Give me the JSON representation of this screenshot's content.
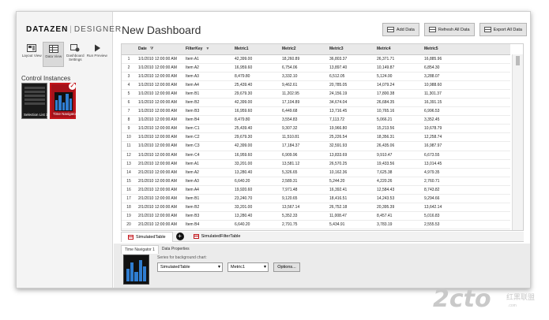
{
  "app": {
    "logo_bold": "DATAZEN",
    "logo_light": "DESIGNER"
  },
  "views": [
    {
      "label": "Layout View",
      "icon": "layout-icon"
    },
    {
      "label": "Data View",
      "icon": "data-view-icon"
    },
    {
      "label": "Dashboard Settings",
      "icon": "dashboard-settings-icon"
    },
    {
      "label": "Run Preview",
      "icon": "play-icon"
    }
  ],
  "control_instances": {
    "title": "Control Instances",
    "items": [
      {
        "label": "Selection List 1"
      },
      {
        "label": "Time Navigator 1"
      }
    ]
  },
  "dashboard": {
    "title": "New Dashboard"
  },
  "toolbar": {
    "add_data": "Add Data",
    "refresh_all": "Refresh All Data",
    "export_all": "Export All Data"
  },
  "table": {
    "columns": [
      "",
      "Date",
      "FilterKey",
      "Metric1",
      "Metric2",
      "Metric3",
      "Metric4",
      "Metric5"
    ],
    "rows": [
      [
        "1",
        "1/1/2010 12:00:00 AM",
        "Item A1",
        "42,399.00",
        "18,260.89",
        "36,803.37",
        "26,371.71",
        "16,885.96"
      ],
      [
        "2",
        "1/1/2010 12:00:00 AM",
        "Item A2",
        "16,959.60",
        "6,754.06",
        "13,897.40",
        "10,149.87",
        "6,854.30"
      ],
      [
        "3",
        "1/1/2010 12:00:00 AM",
        "Item A3",
        "8,479.80",
        "3,332.10",
        "6,512.05",
        "5,124.00",
        "3,288.07"
      ],
      [
        "4",
        "1/1/2010 12:00:00 AM",
        "Item A4",
        "25,439.40",
        "9,462.61",
        "20,785.05",
        "14,079.24",
        "10,988.60"
      ],
      [
        "5",
        "1/1/2010 12:00:00 AM",
        "Item B1",
        "29,679.30",
        "11,202.95",
        "24,156.19",
        "17,800.38",
        "11,301.37"
      ],
      [
        "6",
        "1/1/2010 12:00:00 AM",
        "Item B2",
        "42,399.00",
        "17,104.89",
        "34,674.04",
        "26,684.35",
        "16,391.15"
      ],
      [
        "7",
        "1/1/2010 12:00:00 AM",
        "Item B3",
        "16,959.60",
        "6,449.68",
        "13,716.45",
        "10,765.16",
        "6,996.53"
      ],
      [
        "8",
        "1/1/2010 12:00:00 AM",
        "Item B4",
        "8,479.80",
        "3,554.83",
        "7,113.72",
        "5,066.21",
        "3,352.45"
      ],
      [
        "9",
        "1/1/2010 12:00:00 AM",
        "Item C1",
        "25,439.40",
        "9,307.32",
        "19,966.80",
        "15,213.56",
        "10,678.79"
      ],
      [
        "10",
        "1/1/2010 12:00:00 AM",
        "Item C2",
        "29,679.30",
        "11,510.81",
        "25,226.54",
        "18,356.31",
        "12,258.74"
      ],
      [
        "11",
        "1/1/2010 12:00:00 AM",
        "Item C3",
        "42,399.00",
        "17,184.37",
        "32,591.93",
        "26,435.06",
        "16,987.97"
      ],
      [
        "12",
        "1/1/2010 12:00:00 AM",
        "Item C4",
        "16,959.60",
        "6,909.96",
        "13,833.69",
        "9,910.47",
        "6,673.55"
      ],
      [
        "13",
        "2/1/2010 12:00:00 AM",
        "Item A1",
        "33,201.00",
        "13,581.12",
        "26,570.25",
        "19,433.56",
        "13,014.45"
      ],
      [
        "14",
        "2/1/2010 12:00:00 AM",
        "Item A2",
        "13,280.40",
        "5,326.65",
        "10,162.36",
        "7,625.38",
        "4,979.35"
      ],
      [
        "15",
        "2/1/2010 12:00:00 AM",
        "Item A3",
        "6,640.20",
        "2,589.31",
        "5,244.20",
        "4,220.26",
        "2,760.71"
      ],
      [
        "16",
        "2/1/2010 12:00:00 AM",
        "Item A4",
        "19,920.60",
        "7,971.48",
        "16,392.41",
        "12,584.43",
        "8,743.82"
      ],
      [
        "17",
        "2/1/2010 12:00:00 AM",
        "Item B1",
        "23,240.70",
        "9,120.65",
        "18,416.51",
        "14,243.53",
        "9,294.66"
      ],
      [
        "18",
        "2/1/2010 12:00:00 AM",
        "Item B2",
        "33,201.00",
        "13,567.14",
        "26,752.18",
        "20,395.39",
        "13,642.14"
      ],
      [
        "19",
        "2/1/2010 12:00:00 AM",
        "Item B3",
        "13,280.40",
        "5,352.33",
        "11,008.47",
        "8,457.41",
        "5,016.83"
      ],
      [
        "20",
        "2/1/2010 12:00:00 AM",
        "Item B4",
        "6,640.20",
        "2,791.75",
        "5,434.91",
        "3,783.19",
        "2,555.53"
      ]
    ]
  },
  "tabs": {
    "items": [
      "SimulatedTable",
      "SimulatedFilterTable"
    ]
  },
  "bottom": {
    "tabs": [
      "Time Navigator 1",
      "Data Properties"
    ],
    "series_label": "Series for background chart:",
    "table_select": "SimulatedTable",
    "metric_select": "Metric1",
    "options_button": "Options..."
  },
  "watermark": {
    "main": "2cto",
    "sub": "红黑联盟",
    "url": ".com"
  },
  "colors": {
    "accent": "#c4161c",
    "chart_blue": "#2f7dd1"
  }
}
